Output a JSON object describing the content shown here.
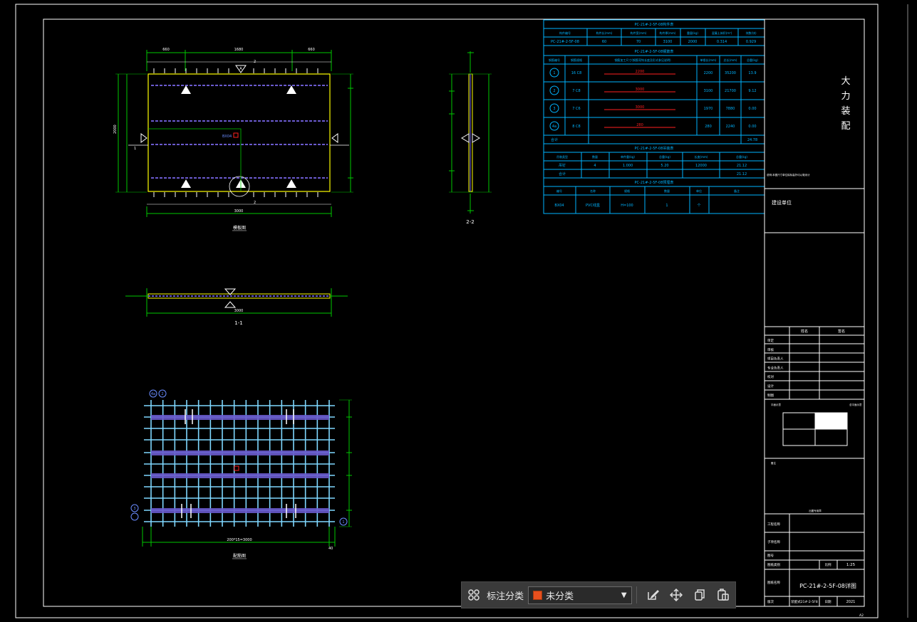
{
  "drawing": {
    "vertical_title_chars": [
      "大",
      "力",
      "装",
      "配"
    ],
    "views": {
      "plan_title": "模板图",
      "section_1_label": "1-1",
      "section_2_label": "2-2",
      "rebar_title": "配筋图"
    },
    "dimensions": {
      "plan_top": [
        "660",
        "1680",
        "660"
      ],
      "plan_overall": "3000",
      "plan_height": "2000",
      "section_width": "3000",
      "rebar_bottom": "200*15=3000",
      "rebar_right": [
        "40",
        "40"
      ]
    },
    "markers": {
      "A": "A",
      "two": "2",
      "one": "1",
      "circle_a": "A"
    },
    "tables": {
      "summary_title": "PC-21#-2-5F-08构件表",
      "summary_headers": [
        "构件编号",
        "构件长(mm)",
        "构件宽(mm)",
        "构件厚(mm)",
        "重量(kg)",
        "混凝土体积(m³)",
        "块数(块)"
      ],
      "summary_row": [
        "PC-21#-2-5F-08",
        "60",
        "70",
        "3100",
        "2000",
        "0.314",
        "0.929"
      ],
      "rebar_title": "PC-21#-2-5F-08钢筋表",
      "rebar_headers": [
        "钢筋编号",
        "钢筋规格",
        "钢筋加工尺寸(钢筋弯钩长度及形式参见说明)",
        "单根长(mm)",
        "总长(mm)",
        "总重(kg)"
      ],
      "rebar_rows": [
        {
          "no": "1",
          "spec": "16 C8",
          "len_label": "2200",
          "len": "2200",
          "total": "35200",
          "weight": "13.9"
        },
        {
          "no": "2",
          "spec": "7 C8",
          "len_label": "3000",
          "len": "3100",
          "total": "21700",
          "weight": "9.12"
        },
        {
          "no": "3",
          "spec": "7 C6",
          "len_label": "3000",
          "len": "1970",
          "total": "7880",
          "weight": "0.00"
        },
        {
          "no": "4a",
          "spec": "8 C8",
          "len_label": "280",
          "len": "280",
          "total": "2240",
          "weight": "0.00"
        }
      ],
      "rebar_total_label": "合计",
      "rebar_total": "24.78",
      "lift_title": "PC-21#-2-5F-08吊装表",
      "lift_headers": [
        "吊装类型",
        "数量",
        "单件重(kg)",
        "总重(kg)",
        "长度(mm)",
        "总重(kg)"
      ],
      "lift_rows": [
        [
          "吊钉",
          "4",
          "1.000",
          "5.20",
          "12000",
          "21.12"
        ],
        [
          "合计",
          "",
          "",
          "",
          "",
          "21.12"
        ]
      ],
      "embed_title": "PC-21#-2-5F-08预埋表",
      "embed_headers": [
        "编号",
        "名称",
        "规格",
        "数量",
        "单位",
        "备注"
      ],
      "embed_row": [
        "BX04",
        "PVC线盒",
        "H=100",
        "1",
        "个",
        ""
      ]
    },
    "title_block": {
      "note": "说明:本图尺寸单位除标高外均以毫米计",
      "design_unit": "建设单位",
      "sign_headers": [
        "姓名",
        "签名"
      ],
      "sign_rows": [
        "审定",
        "审核",
        "项目负责人",
        "专业负责人",
        "校对",
        "设计",
        "制图"
      ],
      "key_plan_left": "平面示意",
      "key_plan_right": "总平面示意",
      "remark": "备注",
      "stamp": "出图专用章",
      "project_name": "工程名称",
      "sub_project": "子项名称",
      "drawing_no_label": "图号",
      "drawing_cat": "图纸类别",
      "scale_label": "比例",
      "scale": "1:25",
      "drawing_name_label": "图纸名称",
      "drawing_name": "PC-21#-2-5F-08详图",
      "version_label": "版次",
      "drawing_code": "装配式21#-2-5F8",
      "date_label": "日期",
      "date": "2021",
      "sheet_size": "A2"
    }
  },
  "toolbar": {
    "label": "标注分类",
    "category": "未分类",
    "category_color": "#e8501e",
    "icons": [
      "apps-icon",
      "edit-icon",
      "move-icon",
      "copy-icon",
      "paste-icon"
    ]
  },
  "colors": {
    "frame": "#ffffff",
    "dimension": "#00c800",
    "table": "#00b4ff",
    "slab_edge": "#ffff00",
    "rebar": "#6a5acd",
    "highlight": "#ff2020"
  }
}
